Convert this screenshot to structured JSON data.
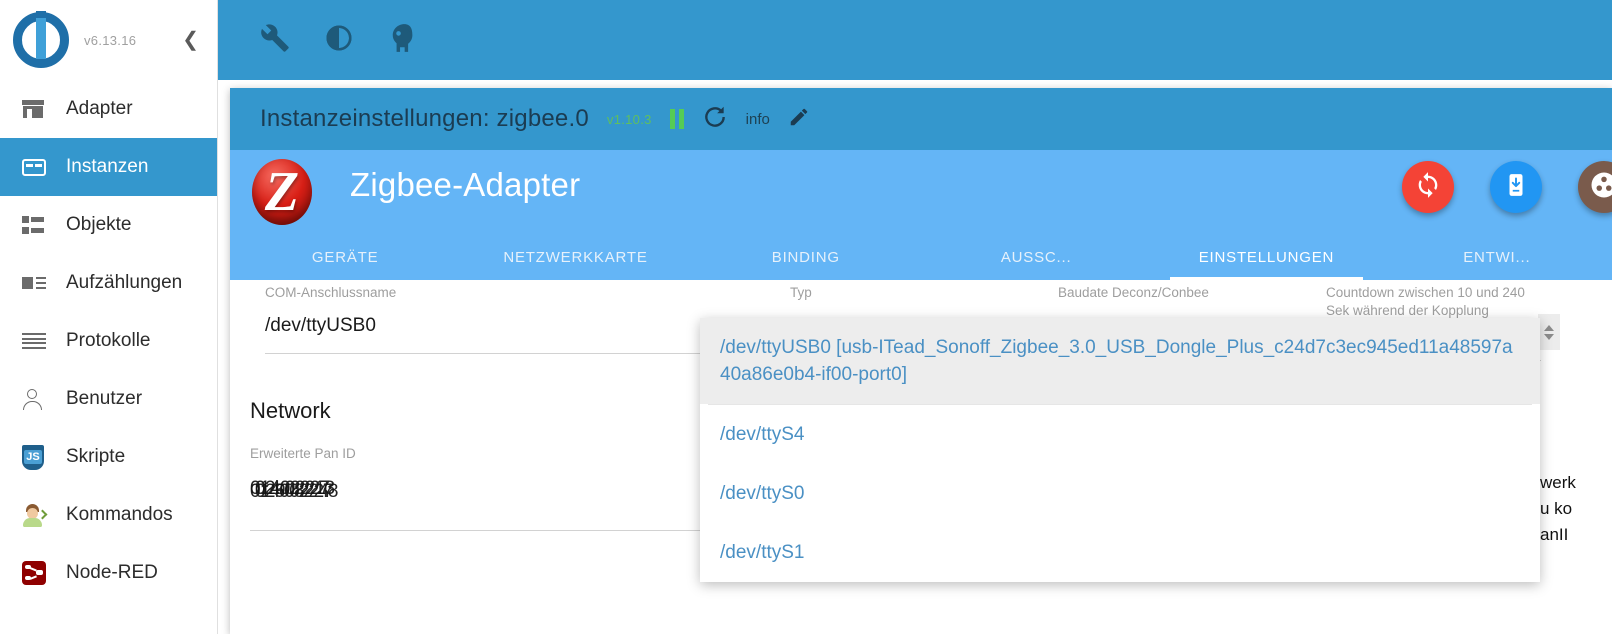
{
  "sidebar": {
    "version": "v6.13.16",
    "collapse_icon": "chevron-left-icon",
    "items": [
      {
        "label": "Adapter",
        "icon": "shop-icon",
        "active": false
      },
      {
        "label": "Instanzen",
        "icon": "instances-icon",
        "active": true
      },
      {
        "label": "Objekte",
        "icon": "objects-icon",
        "active": false
      },
      {
        "label": "Aufzählungen",
        "icon": "enum-icon",
        "active": false
      },
      {
        "label": "Protokolle",
        "icon": "log-icon",
        "active": false
      },
      {
        "label": "Benutzer",
        "icon": "user-icon",
        "active": false
      },
      {
        "label": "Skripte",
        "icon": "js-icon",
        "active": false
      },
      {
        "label": "Kommandos",
        "icon": "command-icon",
        "active": false
      },
      {
        "label": "Node-RED",
        "icon": "node-red-icon",
        "active": false
      }
    ]
  },
  "topbar": {
    "icons": [
      "wrench-icon",
      "contrast-icon",
      "expert-head-icon"
    ],
    "color": "#3497cd"
  },
  "dialog": {
    "title": "Instanzeinstellungen: zigbee.0",
    "version": "v1.10.3",
    "version_color": "#5fbf5f",
    "pause_icon": "pause-icon",
    "refresh_icon": "refresh-icon",
    "info_label": "info",
    "edit_icon": "pencil-icon"
  },
  "banner": {
    "logo_icon": "zigbee-logo-icon",
    "logo_letter": "Z",
    "title": "Zigbee-Adapter",
    "fabs": [
      {
        "name": "sync-fab",
        "icon": "sync-icon",
        "color": "#f44336"
      },
      {
        "name": "download-phone-fab",
        "icon": "phone-download-icon",
        "color": "#2196f3"
      },
      {
        "name": "settings-fab",
        "icon": "dots-icon",
        "color": "#7a5b4c"
      }
    ],
    "tabs": [
      {
        "label": "GERÄTE",
        "active": false
      },
      {
        "label": "NETZWERKKARTE",
        "active": false
      },
      {
        "label": "BINDING",
        "active": false
      },
      {
        "label": "AUSSC...",
        "active": false
      },
      {
        "label": "EINSTELLUNGEN",
        "active": true
      },
      {
        "label": "ENTWI...",
        "active": false
      }
    ]
  },
  "form": {
    "com_label": "COM-Anschlussname",
    "com_value": "/dev/ttyUSB0",
    "typ_label": "Typ",
    "baud_label": "Baudate Deconz/Conbee",
    "countdown_label": "Countdown zwischen 10 und 240 Sek während der Kopplung",
    "network_heading": "Network",
    "panid_label": "Erweiterte Pan ID",
    "panid_value": "00124b0022222173",
    "panid_value_overlay": "0012 45 0008 2222 4 78",
    "clipped_lines": [
      "werk",
      "u ko",
      "anII"
    ]
  },
  "dropdown": {
    "items": [
      {
        "text": "/dev/ttyUSB0 [usb-ITead_Sonoff_Zigbee_3.0_USB_Dongle_Plus_c24d7c3ec945ed11a48597a40a86e0b4-if00-port0]",
        "selected": true
      },
      {
        "text": "/dev/ttyS4",
        "selected": false
      },
      {
        "text": "/dev/ttyS0",
        "selected": false
      },
      {
        "text": "/dev/ttyS1",
        "selected": false
      }
    ]
  }
}
